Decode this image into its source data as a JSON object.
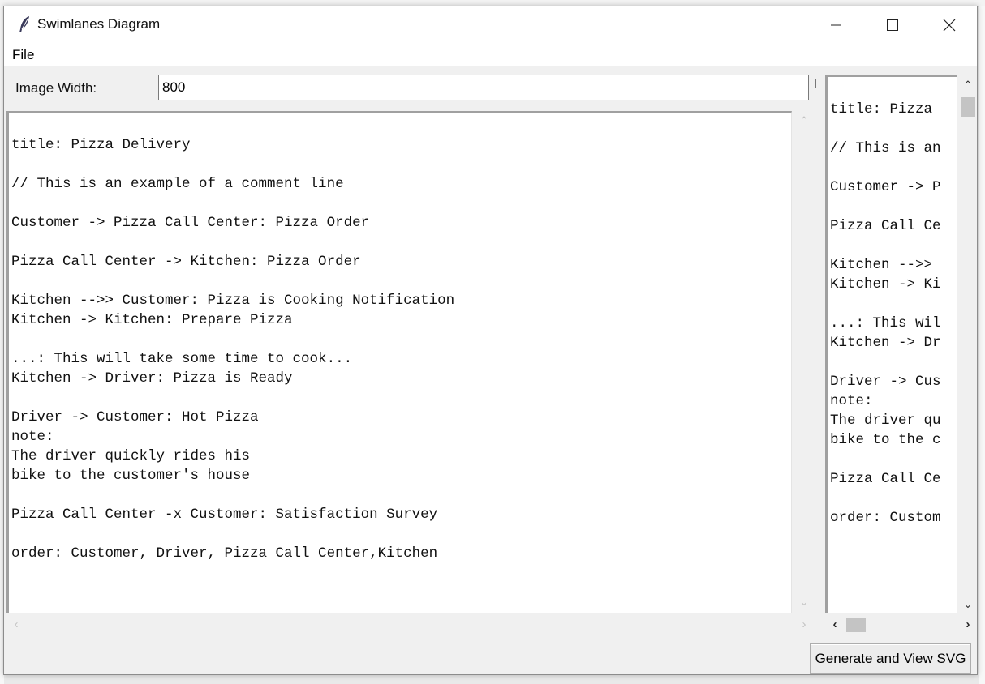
{
  "window": {
    "title": "Swimlanes Diagram"
  },
  "menu": {
    "file": "File"
  },
  "controls": {
    "image_width_label": "Image Width:",
    "image_width_value": "800",
    "generate_button": "Generate and View SVG"
  },
  "editor": {
    "text": "title: Pizza Delivery\n\n// This is an example of a comment line\n\nCustomer -> Pizza Call Center: Pizza Order\n\nPizza Call Center -> Kitchen: Pizza Order\n\nKitchen -->> Customer: Pizza is Cooking Notification\nKitchen -> Kitchen: Prepare Pizza\n\n...: This will take some time to cook...\nKitchen -> Driver: Pizza is Ready\n\nDriver -> Customer: Hot Pizza\nnote:\nThe driver quickly rides his\nbike to the customer's house\n\nPizza Call Center -x Customer: Satisfaction Survey\n\norder: Customer, Driver, Pizza Call Center,Kitchen"
  },
  "preview": {
    "text": "title: Pizza \n\n// This is an\n\nCustomer -> P\n\nPizza Call Ce\n\nKitchen -->> \nKitchen -> Ki\n\n...: This wil\nKitchen -> Dr\n\nDriver -> Cus\nnote:\nThe driver qu\nbike to the c\n\nPizza Call Ce\n\norder: Custom"
  }
}
